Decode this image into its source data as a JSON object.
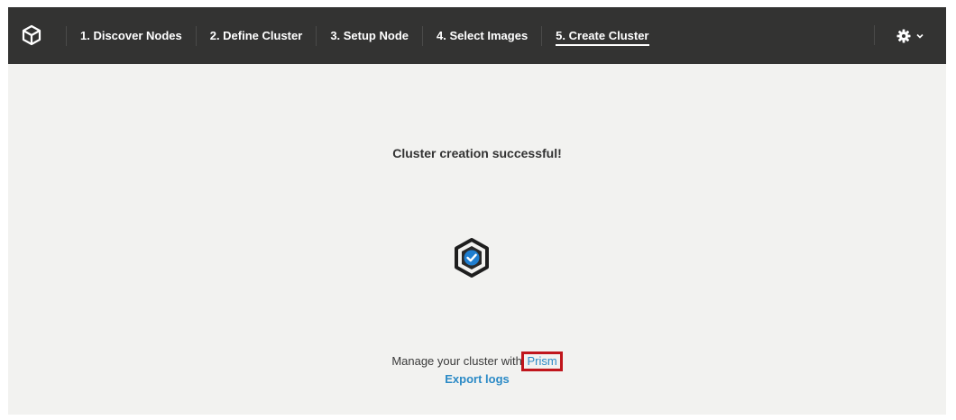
{
  "app": {
    "logo_icon": "cube-hexagon-icon"
  },
  "steps": [
    {
      "label": "1. Discover Nodes",
      "active": false
    },
    {
      "label": "2. Define Cluster",
      "active": false
    },
    {
      "label": "3. Setup Node",
      "active": false
    },
    {
      "label": "4. Select Images",
      "active": false
    },
    {
      "label": "5. Create Cluster",
      "active": true
    }
  ],
  "settings": {
    "icon": "gear-icon",
    "dropdown_icon": "chevron-down-icon"
  },
  "main": {
    "title": "Cluster creation successful!",
    "status_icon": "hexagon-check-icon",
    "manage_text": "Manage your cluster with",
    "prism_link": "Prism",
    "export_link": "Export logs"
  },
  "colors": {
    "topbar": "#333332",
    "background": "#f2f2f0",
    "link": "#2b8ac6",
    "highlight": "#c0161c",
    "check_blue": "#1f7ed0"
  }
}
